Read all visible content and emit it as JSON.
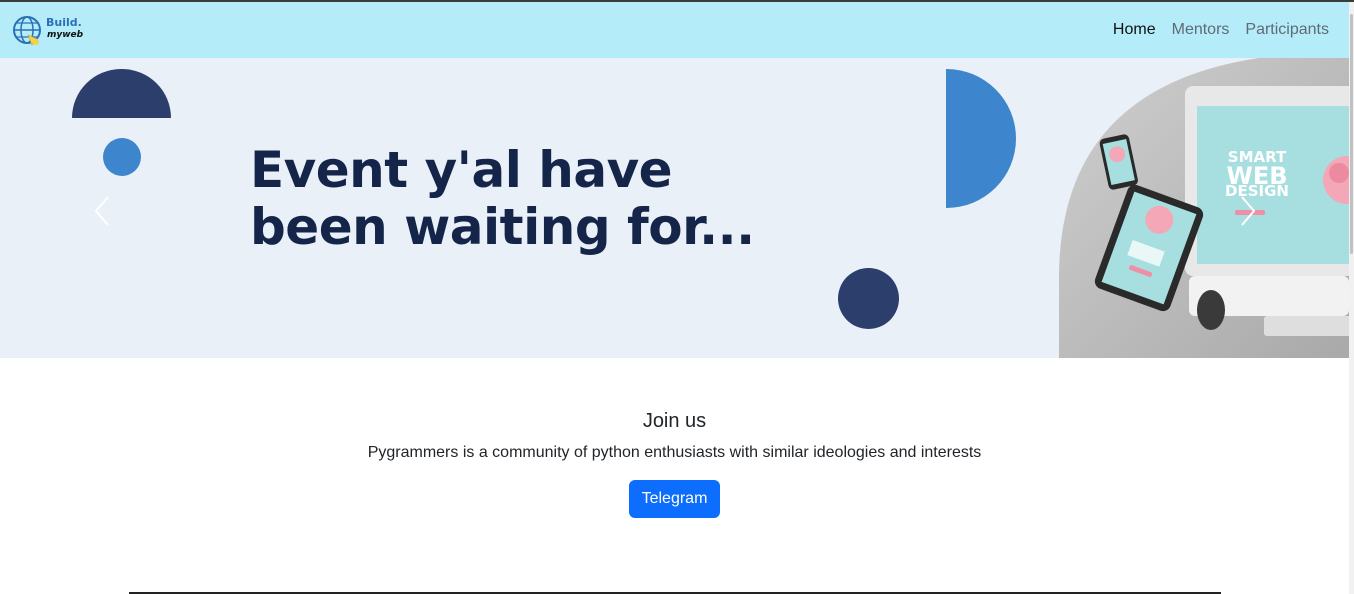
{
  "brand": {
    "line1": "Build.",
    "line2": "myweb"
  },
  "nav": {
    "items": [
      {
        "label": "Home",
        "active": true
      },
      {
        "label": "Mentors",
        "active": false
      },
      {
        "label": "Participants",
        "active": false
      }
    ]
  },
  "hero": {
    "title_line1": "Event y'al have",
    "title_line2": "been waiting for...",
    "image": {
      "line1": "SMART",
      "line2": "WEB",
      "line3": "DESIGN"
    }
  },
  "join": {
    "title": "Join us",
    "description": "Pygrammers is a community of python enthusiasts with similar ideologies and interests",
    "button_label": "Telegram"
  },
  "colors": {
    "navbar_bg": "#b4edf9",
    "hero_bg": "#e9f0f8",
    "navy": "#2c3e6b",
    "accent_blue": "#3d85cc",
    "primary_button": "#0d6efd"
  }
}
